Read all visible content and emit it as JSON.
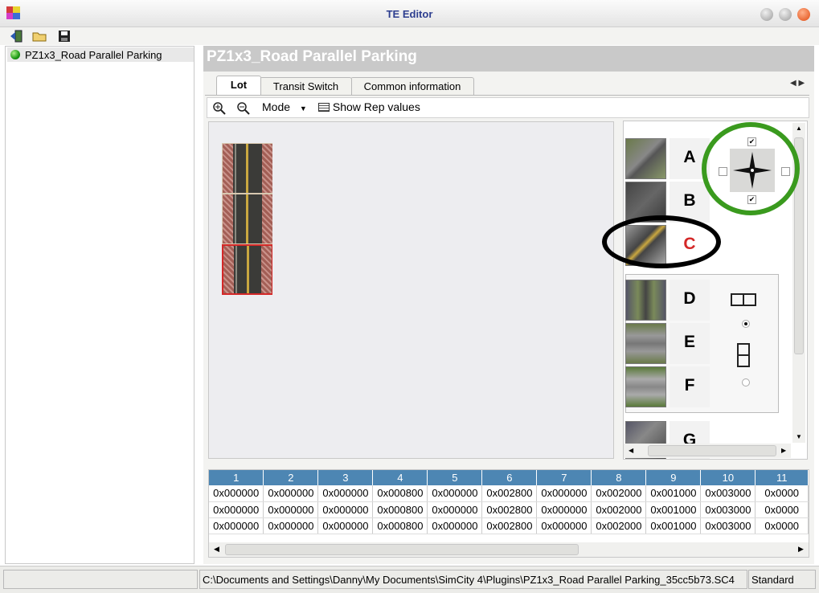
{
  "window": {
    "title": "TE Editor"
  },
  "toolbar": {
    "icons": [
      "exit-icon",
      "open-folder-icon",
      "save-icon"
    ]
  },
  "tree": {
    "items": [
      {
        "label": "PZ1x3_Road Parallel Parking",
        "status_color": "#1d9a15"
      }
    ]
  },
  "panel": {
    "header": "PZ1x3_Road Parallel Parking",
    "tabs": [
      "Lot",
      "Transit Switch",
      "Common information"
    ],
    "subtoolbar": {
      "mode_label": "Mode",
      "show_rep_label": "Show Rep values"
    }
  },
  "tools": {
    "labels": [
      "A",
      "B",
      "C",
      "D",
      "E",
      "F",
      "G"
    ],
    "selected": "C",
    "compass_checks": {
      "top": true,
      "left": false,
      "right": false,
      "bottom": true
    },
    "layout_radio": "horizontal"
  },
  "grid": {
    "headers": [
      "1",
      "2",
      "3",
      "4",
      "5",
      "6",
      "7",
      "8",
      "9",
      "10",
      "11"
    ],
    "rows": [
      [
        "0x000000",
        "0x000000",
        "0x000000",
        "0x000800",
        "0x000000",
        "0x002800",
        "0x000000",
        "0x002000",
        "0x001000",
        "0x003000",
        "0x0000"
      ],
      [
        "0x000000",
        "0x000000",
        "0x000000",
        "0x000800",
        "0x000000",
        "0x002800",
        "0x000000",
        "0x002000",
        "0x001000",
        "0x003000",
        "0x0000"
      ],
      [
        "0x000000",
        "0x000000",
        "0x000000",
        "0x000800",
        "0x000000",
        "0x002800",
        "0x000000",
        "0x002000",
        "0x001000",
        "0x003000",
        "0x0000"
      ]
    ]
  },
  "status": {
    "left": "",
    "path": "C:\\Documents and Settings\\Danny\\My Documents\\SimCity 4\\Plugins\\PZ1x3_Road Parallel Parking_35cc5b73.SC4",
    "mode": "Standard"
  },
  "colors": {
    "accent": "#4d86b3",
    "header_band": "#c9c9c9",
    "selected_red": "#d42828",
    "annotation_green": "#3a9a1e"
  }
}
